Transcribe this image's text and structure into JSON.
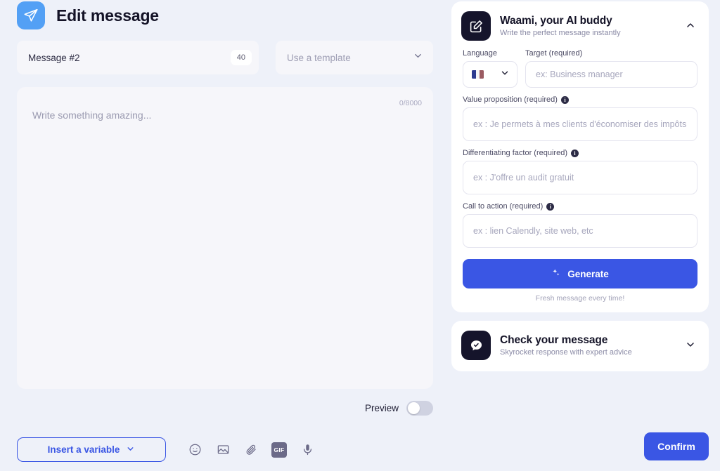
{
  "header": {
    "title": "Edit message",
    "icon": "paper-plane-icon"
  },
  "message_field": {
    "value": "Message #2",
    "badge": "40"
  },
  "template_select": {
    "placeholder": "Use a template",
    "chevron": "chevron-down-icon"
  },
  "editor": {
    "placeholder": "Write something amazing...",
    "counter": "0/8000"
  },
  "preview": {
    "label": "Preview",
    "state": "off"
  },
  "toolbar": {
    "insert_variable_label": "Insert a variable",
    "icons": [
      "emoji-icon",
      "image-icon",
      "paperclip-icon",
      "gif-icon",
      "microphone-icon"
    ],
    "gif_label": "GIF"
  },
  "confirm": {
    "label": "Confirm"
  },
  "waami_card": {
    "title": "Waami, your AI buddy",
    "subtitle": "Write the perfect message instantly",
    "icon": "edit-square-icon",
    "collapse_icon": "chevron-up-icon",
    "language": {
      "label": "Language",
      "flag": "france-flag-icon"
    },
    "target": {
      "label": "Target (required)",
      "placeholder": "ex: Business manager"
    },
    "value_proposition": {
      "label": "Value proposition (required)",
      "placeholder": "ex : Je permets à mes clients d'économiser des impôts",
      "info": "i"
    },
    "differentiating_factor": {
      "label": "Differentiating factor (required)",
      "placeholder": "ex : J'offre un audit gratuit",
      "info": "i"
    },
    "call_to_action": {
      "label": "Call to action (required)",
      "placeholder": "ex : lien Calendly, site web, etc",
      "info": "i"
    },
    "generate": {
      "label": "Generate",
      "icon": "sparkle-icon",
      "note": "Fresh message every time!"
    }
  },
  "check_card": {
    "title": "Check your message",
    "subtitle": "Skyrocket response with expert advice",
    "icon": "chat-check-icon",
    "expand_icon": "chevron-down-icon"
  },
  "colors": {
    "background": "#eef1f9",
    "accent": "#3a56e4",
    "app_icon": "#53a0f5",
    "dark": "#15142b"
  }
}
